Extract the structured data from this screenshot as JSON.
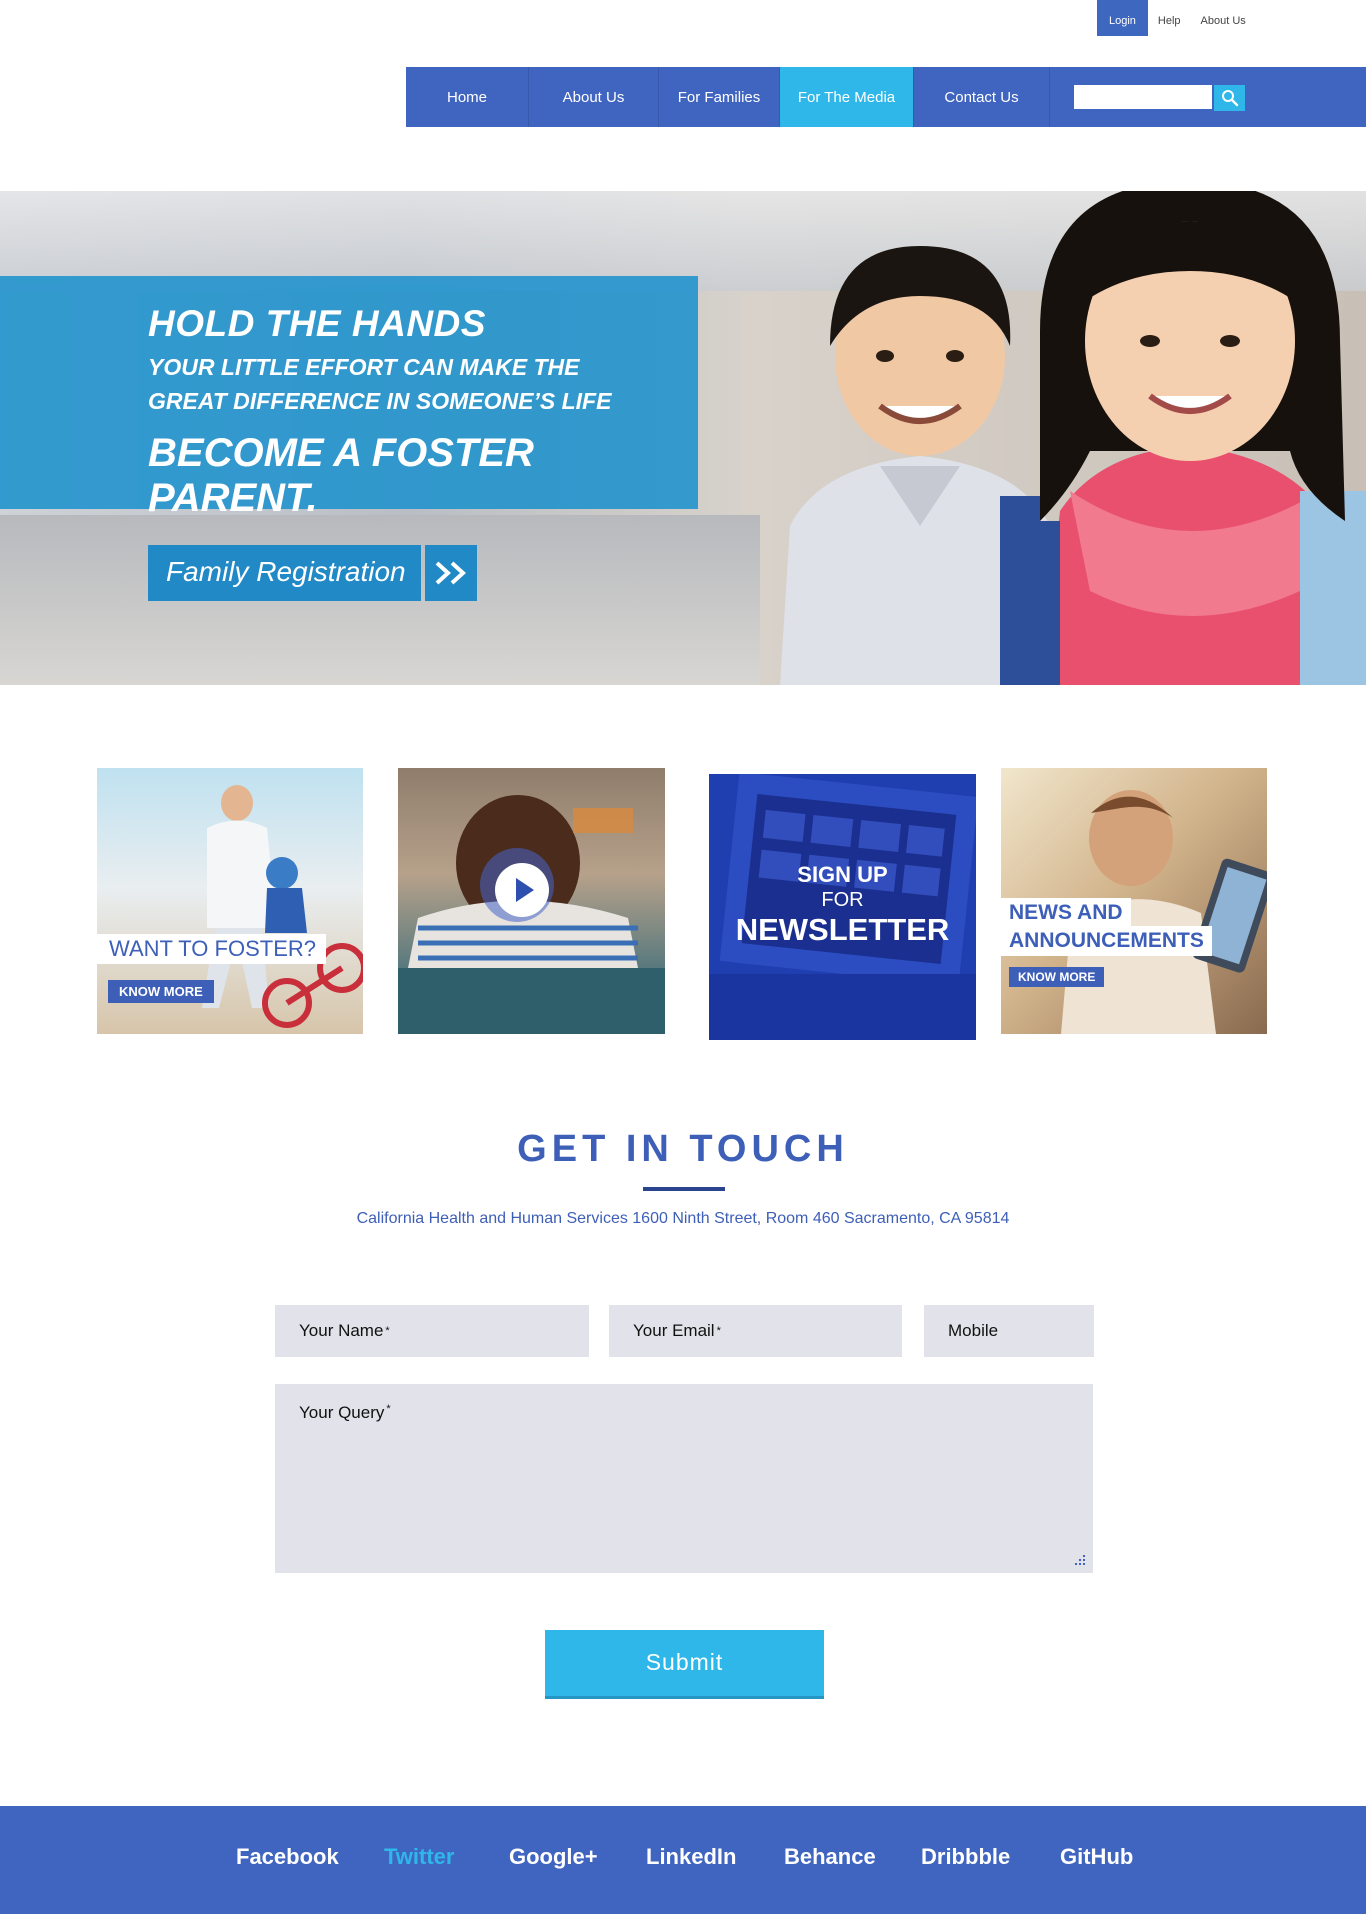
{
  "utility_nav": [
    "Login",
    "Help",
    "About Us"
  ],
  "main_nav": [
    "Home",
    "About Us",
    "For Families",
    "For The Media",
    "Contact Us"
  ],
  "search": {
    "placeholder": "",
    "button_icon": "search-icon"
  },
  "hero": {
    "title": "HOLD THE HANDS",
    "subtitle_line1": "YOUR LITTLE EFFORT CAN MAKE THE",
    "subtitle_line2": "GREAT DIFFERENCE IN SOMEONE’S LIFE",
    "cta_text": "BECOME A FOSTER PARENT.",
    "button_label": "Family Registration",
    "button_icon": "double-chevron-right-icon"
  },
  "tiles": {
    "foster": {
      "caption": "WANT TO FOSTER?",
      "button": "KNOW MORE"
    },
    "video": {
      "icon": "play-icon"
    },
    "newsletter": {
      "line1": "SIGN UP",
      "line2": "FOR",
      "line3": "NEWSLETTER"
    },
    "news": {
      "caption_line1": "NEWS AND",
      "caption_line2": "ANNOUNCEMENTS",
      "button": "KNOW MORE"
    }
  },
  "contact": {
    "title": "GET IN TOUCH",
    "address": "California Health and Human Services 1600 Ninth Street, Room 460 Sacramento, CA 95814",
    "name_placeholder": "Your Name",
    "email_placeholder": "Your Email",
    "mobile_placeholder": "Mobile",
    "query_placeholder": "Your Query",
    "required_mark": "*",
    "submit_label": "Submit"
  },
  "footer": {
    "social_links": [
      "Facebook",
      "Twitter",
      "Google+",
      "LinkedIn",
      "Behance",
      "Dribbble",
      "GitHub"
    ]
  },
  "colors": {
    "brand_blue": "#4065c0",
    "accent_cyan": "#2eb7e8",
    "hero_panel": "#1e92cd",
    "field_bg": "#e2e3ea"
  }
}
